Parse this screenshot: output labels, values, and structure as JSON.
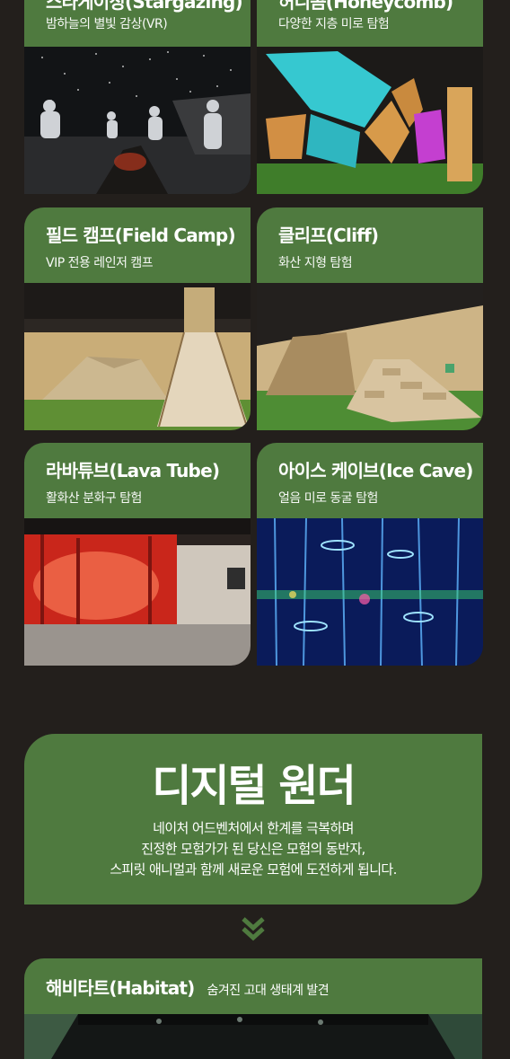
{
  "cards": [
    {
      "title": "스타게이징(Stargazing)",
      "subtitle": "밤하늘의 별빛 감상(VR)",
      "photo": "stargazing-vr-photo"
    },
    {
      "title": "허니콤(Honeycomb)",
      "subtitle": "다양한 지층 미로 탐험",
      "photo": "honeycomb-maze-photo"
    },
    {
      "title": "필드 캠프(Field Camp)",
      "subtitle": "VIP 전용 레인저 캠프",
      "photo": "field-camp-photo"
    },
    {
      "title": "클리프(Cliff)",
      "subtitle": "화산 지형 탐험",
      "photo": "cliff-photo"
    },
    {
      "title": "라바튜브(Lava Tube)",
      "subtitle": "활화산 분화구 탐험",
      "photo": "lava-tube-photo"
    },
    {
      "title": "아이스 케이브(Ice Cave)",
      "subtitle": "얼음 미로 동굴 탐험",
      "photo": "ice-cave-photo"
    }
  ],
  "banner": {
    "title": "디지털 원더",
    "lines": [
      "네이처 어드벤처에서 한계를 극복하며",
      "진정한 모험가가 된 당신은 모험의 동반자,",
      "스피릿 애니멀과 함께 새로운 모험에 도전하게 됩니다."
    ]
  },
  "chevron_icon": "double-chevron-down-icon",
  "habitat": {
    "title": "해비타트(Habitat)",
    "subtitle": "숨겨진 고대 생태계 발견",
    "photo": "habitat-photo"
  },
  "colors": {
    "background": "#231f1c",
    "accent_green": "#4f7a3f",
    "text": "#ffffff"
  }
}
